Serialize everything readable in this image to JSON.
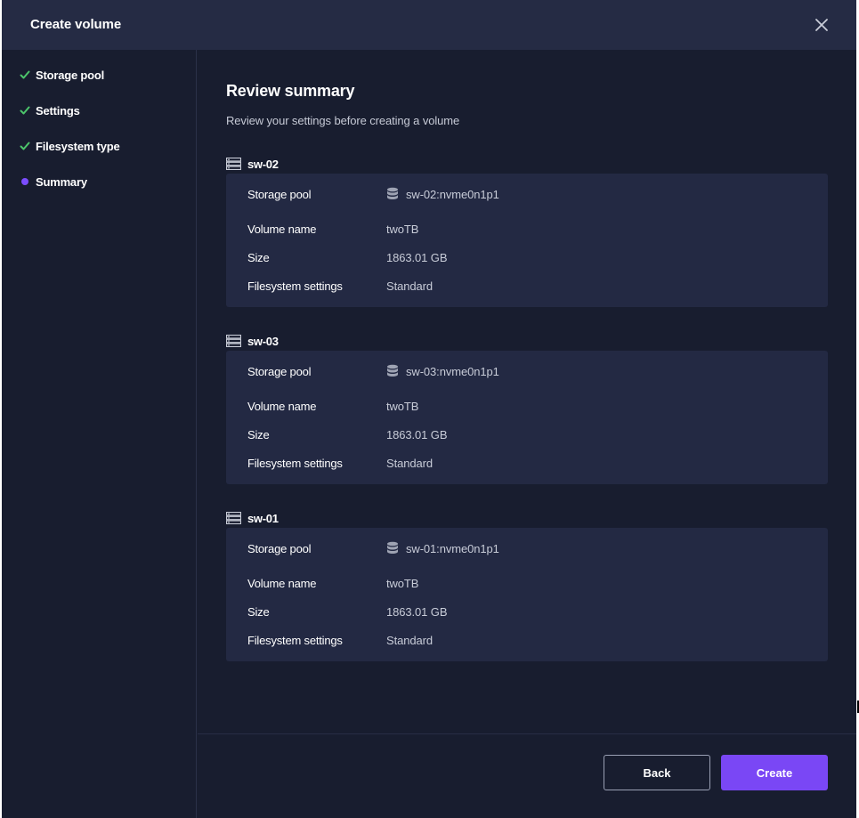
{
  "dialog": {
    "title": "Create volume",
    "close_icon": "close-icon"
  },
  "steps": [
    {
      "label": "Storage pool",
      "state": "completed",
      "icon": "check-icon"
    },
    {
      "label": "Settings",
      "state": "completed",
      "icon": "check-icon"
    },
    {
      "label": "Filesystem type",
      "state": "completed",
      "icon": "check-icon"
    },
    {
      "label": "Summary",
      "state": "current",
      "icon": "dot-icon"
    }
  ],
  "review": {
    "title": "Review summary",
    "subtitle": "Review your settings before creating a volume"
  },
  "field_labels": {
    "storage_pool": "Storage pool",
    "volume_name": "Volume name",
    "size": "Size",
    "filesystem_settings": "Filesystem settings"
  },
  "nodes": [
    {
      "name": "sw-02",
      "storage_pool": "sw-02:nvme0n1p1",
      "volume_name": "twoTB",
      "size": "1863.01 GB",
      "filesystem_settings": "Standard"
    },
    {
      "name": "sw-03",
      "storage_pool": "sw-03:nvme0n1p1",
      "volume_name": "twoTB",
      "size": "1863.01 GB",
      "filesystem_settings": "Standard"
    },
    {
      "name": "sw-01",
      "storage_pool": "sw-01:nvme0n1p1",
      "volume_name": "twoTB",
      "size": "1863.01 GB",
      "filesystem_settings": "Standard"
    }
  ],
  "buttons": {
    "back": "Back",
    "create": "Create"
  },
  "colors": {
    "background": "#181d2f",
    "header": "#252b44",
    "card": "#232943",
    "accent": "#7a47f5",
    "check": "#4cc56b"
  }
}
